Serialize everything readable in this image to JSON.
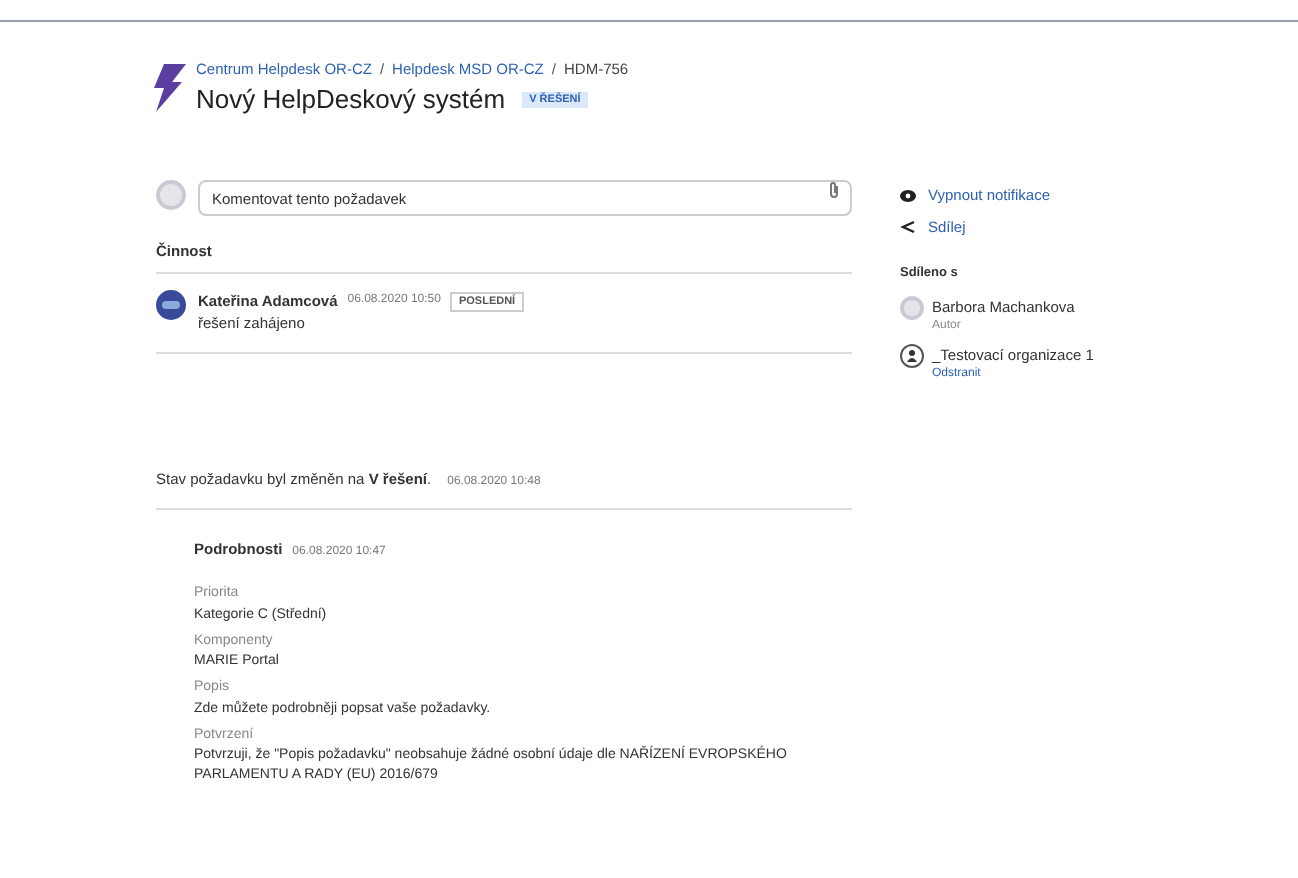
{
  "breadcrumbs": [
    "Centrum Helpdesk OR-CZ",
    "Helpdesk MSD OR-CZ",
    "HDM-756"
  ],
  "breadcrumb_separators": [
    "/",
    "/"
  ],
  "title": "Nový HelpDeskový systém",
  "status_badge": "V ŘEŠENÍ",
  "comment": {
    "placeholder": "Komentovat tento požadavek"
  },
  "activity": {
    "heading": "Činnost",
    "entries": [
      {
        "author": "Kateřina Adamcová",
        "time": "06.08.2020 10:50",
        "badge": "POSLEDNÍ",
        "text": "řešení zahájeno"
      }
    ]
  },
  "status_change": {
    "text": "Stav požadavku byl změněn na **V řešení**.",
    "time": "06.08.2020 10:48"
  },
  "details": {
    "heading": "Podrobnosti",
    "time": "06.08.2020 10:47",
    "fields": [
      {
        "label": "Priorita",
        "value": "Kategorie C (Střední)"
      },
      {
        "label": "Komponenty",
        "value": "MARIE Portal"
      },
      {
        "label": "Popis",
        "value": "Zde můžete podrobněji popsat vaše požadavky."
      },
      {
        "label": "Potvrzení",
        "value": "Potvrzuji, že \"Popis požadavku\" neobsahuje žádné osobní údaje dle NAŘÍZENÍ EVROPSKÉHO PARLAMENTU A RADY (EU) 2016/679"
      }
    ]
  },
  "sidebar": {
    "actions": [
      {
        "kind": "notify",
        "label": "Vypnout notifikace"
      },
      {
        "kind": "share",
        "label": "Sdílej"
      }
    ],
    "shared_heading": "Sdíleno s",
    "shared": [
      {
        "kind": "person",
        "name": "Barbora Machankova",
        "sub": "Autor"
      },
      {
        "kind": "organization",
        "name": "_Testovací organizace 1",
        "sub": "Odstranit"
      }
    ]
  }
}
